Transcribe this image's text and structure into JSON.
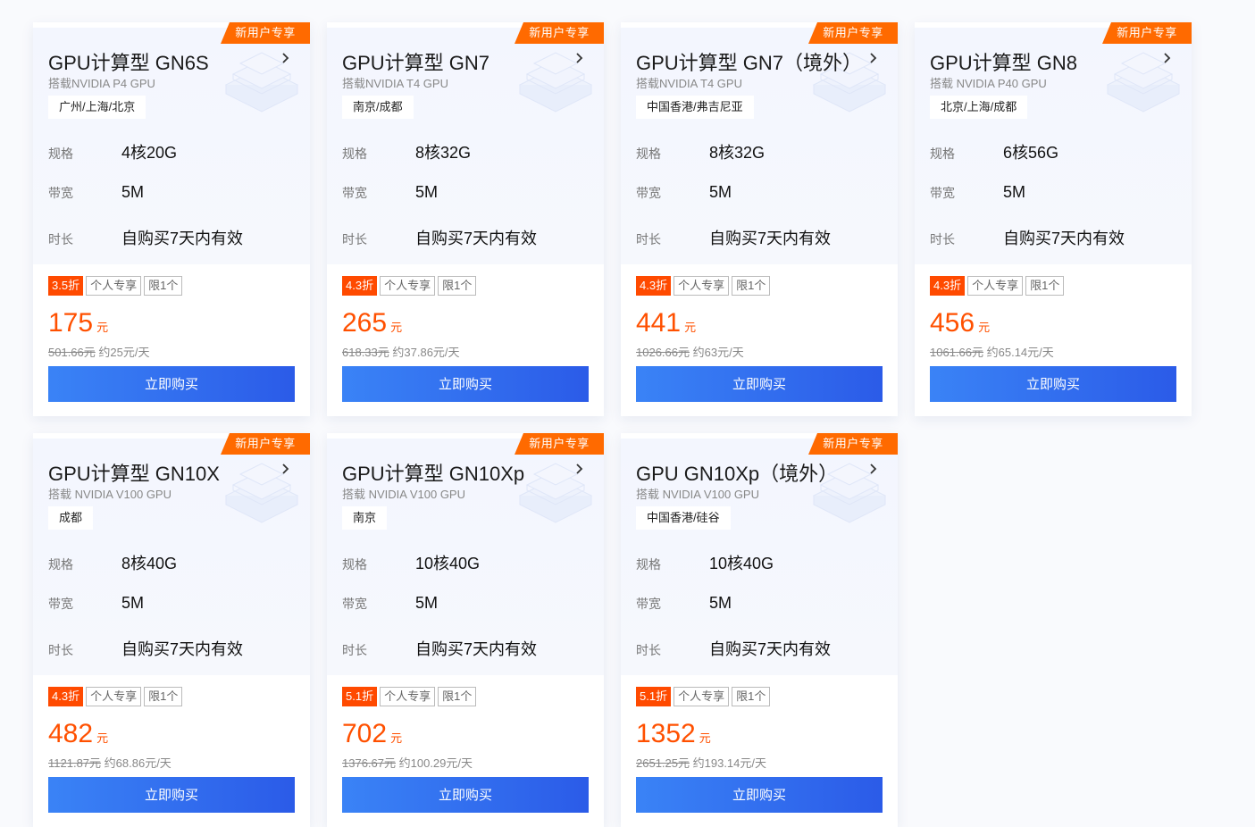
{
  "labels": {
    "spec": "规格",
    "bandwidth": "带宽",
    "duration": "时长",
    "buy": "立即购买",
    "ribbon": "新用户专享",
    "unit": "元"
  },
  "cards": [
    {
      "title": "GPU计算型 GN6S",
      "subtitle": "搭载NVIDIA P4 GPU",
      "region": "广州/上海/北京",
      "spec": "4核20G",
      "bandwidth": "5M",
      "duration": "自购买7天内有效",
      "discount": "3.5折",
      "tag1": "个人专享",
      "tag2": "限1个",
      "price": "175",
      "original": "501.66元",
      "per_day": "约25元/天"
    },
    {
      "title": "GPU计算型 GN7",
      "subtitle": "搭载NVIDIA T4 GPU",
      "region": "南京/成都",
      "spec": "8核32G",
      "bandwidth": "5M",
      "duration": "自购买7天内有效",
      "discount": "4.3折",
      "tag1": "个人专享",
      "tag2": "限1个",
      "price": "265",
      "original": "618.33元",
      "per_day": "约37.86元/天"
    },
    {
      "title": "GPU计算型 GN7（境外）",
      "subtitle": "搭载NVIDIA T4 GPU",
      "region": "中国香港/弗吉尼亚",
      "spec": "8核32G",
      "bandwidth": "5M",
      "duration": "自购买7天内有效",
      "discount": "4.3折",
      "tag1": "个人专享",
      "tag2": "限1个",
      "price": "441",
      "original": "1026.66元",
      "per_day": "约63元/天"
    },
    {
      "title": "GPU计算型 GN8",
      "subtitle": "搭载 NVIDIA P40 GPU",
      "region": "北京/上海/成都",
      "spec": "6核56G",
      "bandwidth": "5M",
      "duration": "自购买7天内有效",
      "discount": "4.3折",
      "tag1": "个人专享",
      "tag2": "限1个",
      "price": "456",
      "original": "1061.66元",
      "per_day": "约65.14元/天"
    },
    {
      "title": "GPU计算型 GN10X",
      "subtitle": "搭载 NVIDIA V100 GPU",
      "region": "成都",
      "spec": "8核40G",
      "bandwidth": "5M",
      "duration": "自购买7天内有效",
      "discount": "4.3折",
      "tag1": "个人专享",
      "tag2": "限1个",
      "price": "482",
      "original": "1121.87元",
      "per_day": "约68.86元/天"
    },
    {
      "title": "GPU计算型 GN10Xp",
      "subtitle": "搭载 NVIDIA V100 GPU",
      "region": "南京",
      "spec": "10核40G",
      "bandwidth": "5M",
      "duration": "自购买7天内有效",
      "discount": "5.1折",
      "tag1": "个人专享",
      "tag2": "限1个",
      "price": "702",
      "original": "1376.67元",
      "per_day": "约100.29元/天"
    },
    {
      "title": "GPU GN10Xp（境外）",
      "subtitle": "搭载 NVIDIA V100 GPU",
      "region": "中国香港/硅谷",
      "spec": "10核40G",
      "bandwidth": "5M",
      "duration": "自购买7天内有效",
      "discount": "5.1折",
      "tag1": "个人专享",
      "tag2": "限1个",
      "price": "1352",
      "original": "2651.25元",
      "per_day": "约193.14元/天"
    }
  ]
}
